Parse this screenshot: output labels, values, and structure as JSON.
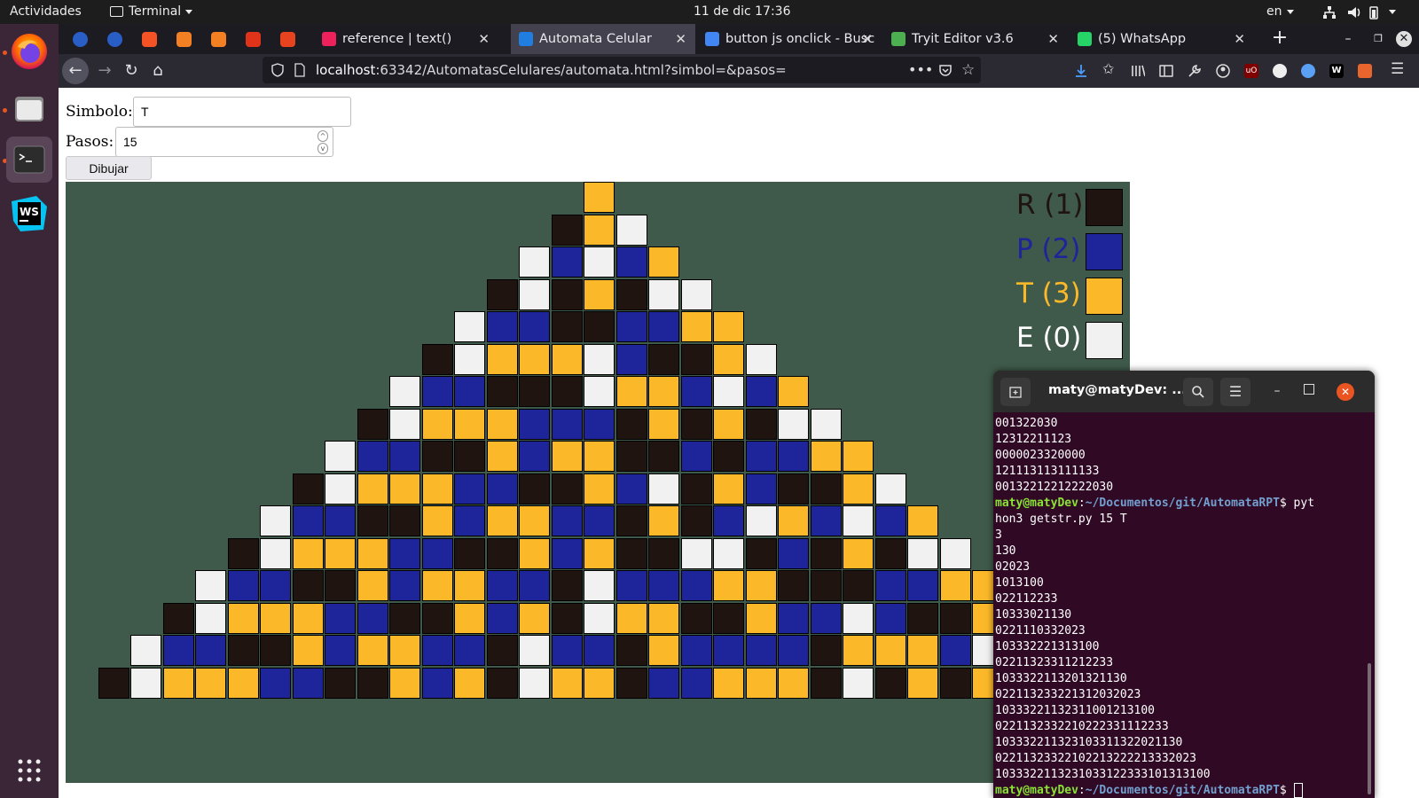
{
  "topbar": {
    "activities": "Actividades",
    "app": "Terminal",
    "clock": "11 de dic  17:36",
    "lang": "en"
  },
  "dock": {
    "items": [
      "firefox",
      "files",
      "terminal",
      "webstorm"
    ]
  },
  "browser": {
    "pinned_icons": [
      "firefox-icon",
      "firefox-icon",
      "microsoft-icon",
      "stackoverflow-icon",
      "stackoverflow-icon",
      "ask-icon",
      "c-icon"
    ],
    "tabs": [
      {
        "label": "reference | text()",
        "active": false,
        "icon_color": "#ed225d"
      },
      {
        "label": "Automata Celular",
        "active": true,
        "icon_color": "#1f7ee0"
      },
      {
        "label": "button js onclick - Busc",
        "active": false,
        "icon_color": "#4285f4"
      },
      {
        "label": "Tryit Editor v3.6",
        "active": false,
        "icon_color": "#4caf50"
      },
      {
        "label": "(5) WhatsApp",
        "active": false,
        "icon_color": "#25d366"
      }
    ],
    "url_host": "localhost",
    "url_rest": ":63342/AutomatasCelulares/automata.html?simbol=&pasos="
  },
  "form": {
    "simbolo_label": "Simbolo:",
    "simbolo_value": "T",
    "pasos_label": "Pasos:",
    "pasos_value": "15",
    "button_label": "Dibujar"
  },
  "legend": [
    {
      "label": "R (1)",
      "color": "#1f1410"
    },
    {
      "label": "P (2)",
      "color": "#1e249a"
    },
    {
      "label": "T (3)",
      "color": "#fbb829"
    },
    {
      "label": "E (0)",
      "color": "#f1f1f1"
    }
  ],
  "automaton": {
    "colors": {
      "0": "#f1f1f1",
      "1": "#1f1410",
      "2": "#1e249a",
      "3": "#fbb829"
    },
    "rows": [
      "3",
      "130",
      "02023",
      "1013100",
      "022112233",
      "10333021130",
      "0221110332023",
      "103332221313100",
      "02211323311212233",
      "1033322113201321130",
      "022113233221312032023",
      "10333221132311001213100",
      "0221132332210222331112233",
      "103332211323103311322021130",
      "02211323322102213222213332023",
      "1033322113231033122333101313100"
    ]
  },
  "terminal": {
    "title": "maty@matyDev: ...",
    "prompt_user": "maty@matyDev",
    "prompt_path": "~/Documentos/git/AutomataRPT",
    "lines_before": [
      "001322030",
      "12312211123",
      "0000023320000",
      "121113113111133",
      "00132212212222030"
    ],
    "command_line1": "$ pyt",
    "command_line2": "hon3 getstr.py 15 T",
    "output": [
      "3",
      "130",
      "02023",
      "1013100",
      "022112233",
      "10333021130",
      "0221110332023",
      "103332221313100",
      "02211323311212233",
      "1033322113201321130",
      "022113233221312032023",
      "10333221132311001213100",
      "0221132332210222331112233",
      "103332211323103311322021130",
      "02211323322102213222213332023",
      "1033322113231033122333101313100"
    ],
    "final_prompt_suffix": "$ "
  }
}
